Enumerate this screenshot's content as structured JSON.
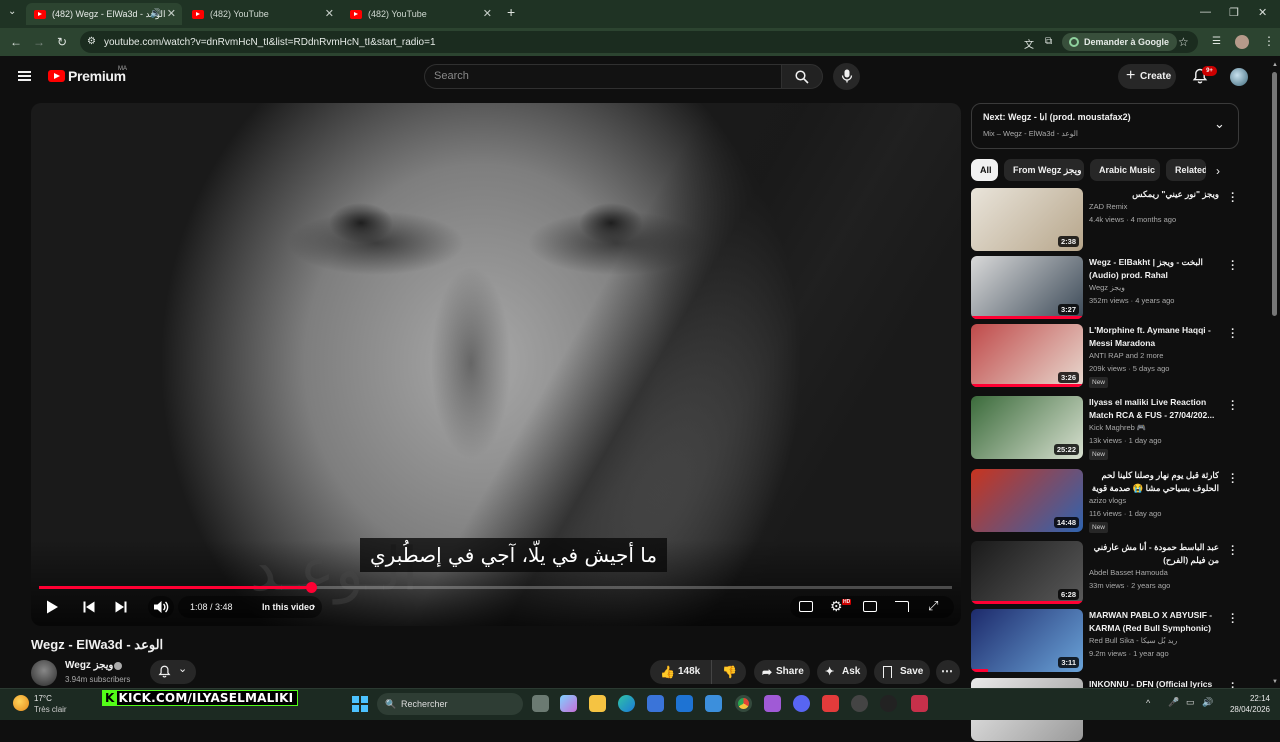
{
  "browser": {
    "tabs": [
      {
        "title": "(482) Wegz - ElWa3d - الوعد",
        "active": true
      },
      {
        "title": "(482) YouTube",
        "active": false
      },
      {
        "title": "(482) YouTube",
        "active": false
      }
    ],
    "url": "youtube.com/watch?v=dnRvmHcN_tI&list=RDdnRvmHcN_tI&start_radio=1",
    "translate_label": "Demander à Google"
  },
  "header": {
    "logo_text": "Premium",
    "country": "MA",
    "search_placeholder": "Search",
    "create_label": "Create",
    "notif_count": "9+"
  },
  "player": {
    "subtitle": "ما أجيش في يلّا، آجي في إصطُبري",
    "watermark": "الـوعـد",
    "time": "1:08 / 3:48",
    "progress": 0.298,
    "in_this_video": "In this video",
    "hd_badge": "HD"
  },
  "video": {
    "title": "Wegz - ElWa3d - الوعد",
    "channel": "Wegz ويجز",
    "subscribers": "3.94m subscribers",
    "likes": "148k",
    "share": "Share",
    "ask": "Ask",
    "save": "Save"
  },
  "sidebar": {
    "next_title": "Next: Wegz - انا (prod. moustafax2)",
    "next_sub": "Mix – Wegz - ElWa3d - الوعد",
    "chips": [
      "All",
      "From Wegz ويجز",
      "Arabic Music",
      "Related"
    ],
    "recs": [
      {
        "title": "ويجز \"نور عيني\" ريمكس",
        "channel": "ZAD Remix",
        "meta": "4.4k views · 4 months ago",
        "duration": "2:38",
        "new": "",
        "verified": false,
        "watched": 0,
        "colors": [
          "#e9e4da",
          "#b7a68b"
        ]
      },
      {
        "title": "Wegz - ElBakht | البخت - ويجز (Audio) prod. Rahal",
        "channel": "Wegz ويجز",
        "meta": "352m views · 4 years ago",
        "duration": "3:27",
        "new": "",
        "verified": true,
        "watched": 1.0,
        "colors": [
          "#d9d9d9",
          "#3c4a58"
        ]
      },
      {
        "title": "L'Morphine ft. Aymane Haqqi - Messi Maradona",
        "channel": "ANTI RAP  and 2 more",
        "meta": "209k views · 5 days ago",
        "duration": "3:26",
        "new": "New",
        "verified": true,
        "watched": 1.0,
        "colors": [
          "#c04a4a",
          "#e8d9cf"
        ]
      },
      {
        "title": "Ilyass el maliki Live Reaction Match RCA & FUS - 27/04/202...",
        "channel": "Kick Maghreb 🎮",
        "meta": "13k views · 1 day ago",
        "duration": "25:22",
        "new": "New",
        "verified": false,
        "watched": 0,
        "colors": [
          "#3b6b3b",
          "#d8e0d0"
        ]
      },
      {
        "title": "كارثة قبل يوم نهار وصلنا كلينا لحم الحلوف بسياحي مشا 😭 صدمة قوية 😳",
        "channel": "azizo vlogs",
        "meta": "116 views · 1 day ago",
        "duration": "14:48",
        "new": "New",
        "verified": false,
        "watched": 0,
        "colors": [
          "#c8341f",
          "#2f64b0"
        ]
      },
      {
        "title": "عبد الباسط حمودة - أنا مش عارفني من فيلم (الفرح)",
        "channel": "Abdel Basset Hamouda",
        "meta": "33m views · 2 years ago",
        "duration": "6:28",
        "new": "",
        "verified": true,
        "watched": 1.0,
        "colors": [
          "#1a1a1a",
          "#5a5a5a"
        ]
      },
      {
        "title": "MARWAN PABLO X ABYUSIF - KARMA (Red Bull Symphonic) ...",
        "channel": "Red Bull Sika - ريد بُل سيكا",
        "meta": "9.2m views · 1 year ago",
        "duration": "3:11",
        "new": "",
        "verified": true,
        "watched": 0.15,
        "colors": [
          "#1d2a6b",
          "#6aa3d8"
        ]
      },
      {
        "title": "INKONNU - DFN (Official lyrics",
        "channel": "",
        "meta": "",
        "duration": "",
        "new": "",
        "verified": false,
        "watched": 0,
        "colors": [
          "#e9e9e9",
          "#9a9a9a"
        ]
      }
    ]
  },
  "taskbar": {
    "temperature": "17°C",
    "condition": "Très clair",
    "stream_overlay": "KICK.COM/ILYASELMALIKI",
    "search_label": "Rechercher",
    "time": "22:14",
    "date": "28/04/2026"
  }
}
